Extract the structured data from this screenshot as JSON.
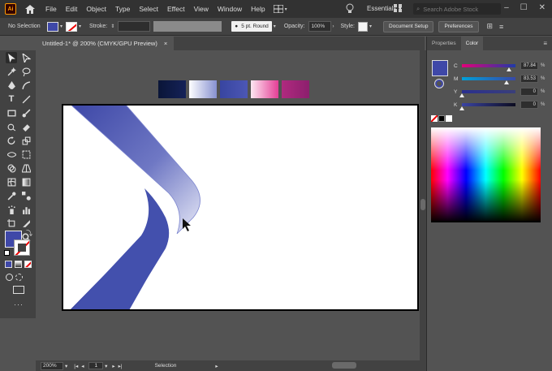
{
  "app": {
    "logo": "Ai",
    "menus": [
      "File",
      "Edit",
      "Object",
      "Type",
      "Select",
      "Effect",
      "View",
      "Window",
      "Help"
    ],
    "workspace": "Essentials",
    "search_placeholder": "Search Adobe Stock"
  },
  "control_bar": {
    "selection_label": "No Selection",
    "stroke_label": "Stroke:",
    "brush_value": "5 pt. Round",
    "opacity_label": "Opacity:",
    "opacity_value": "100%",
    "style_label": "Style:",
    "document_setup": "Document Setup",
    "preferences": "Preferences"
  },
  "document": {
    "tab_title": "Untitled-1* @ 200% (CMYK/GPU Preview)",
    "close_glyph": "×"
  },
  "status_bar": {
    "zoom": "200%",
    "artboard_number": "1",
    "tool_name": "Selection"
  },
  "panels": {
    "tabs": [
      "Properties",
      "Color"
    ],
    "active_tab": "Color",
    "cmyk": [
      {
        "channel": "C",
        "value": "87.84",
        "fraction": 0.8784
      },
      {
        "channel": "M",
        "value": "83.53",
        "fraction": 0.8353
      },
      {
        "channel": "Y",
        "value": "0",
        "fraction": 0
      },
      {
        "channel": "K",
        "value": "0",
        "fraction": 0
      }
    ],
    "percent_sign": "%"
  },
  "swatches": [
    "#0c1a43",
    "#c9d0ee",
    "#3f4aa6",
    "#e94fa0",
    "#a3277a"
  ],
  "colors": {
    "fill": "#3f48a8",
    "accent_blue": "#3f48a8",
    "shape_light": "#d8ddf0"
  }
}
